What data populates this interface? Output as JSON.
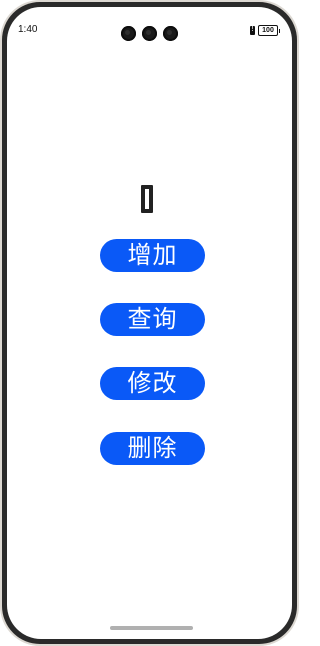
{
  "status_bar": {
    "time": "1:40",
    "battery": "100"
  },
  "main": {
    "display_glyph": "▯",
    "buttons": {
      "add": "增加",
      "query": "查询",
      "edit": "修改",
      "delete": "删除"
    },
    "button_color": "#0a59f7"
  }
}
